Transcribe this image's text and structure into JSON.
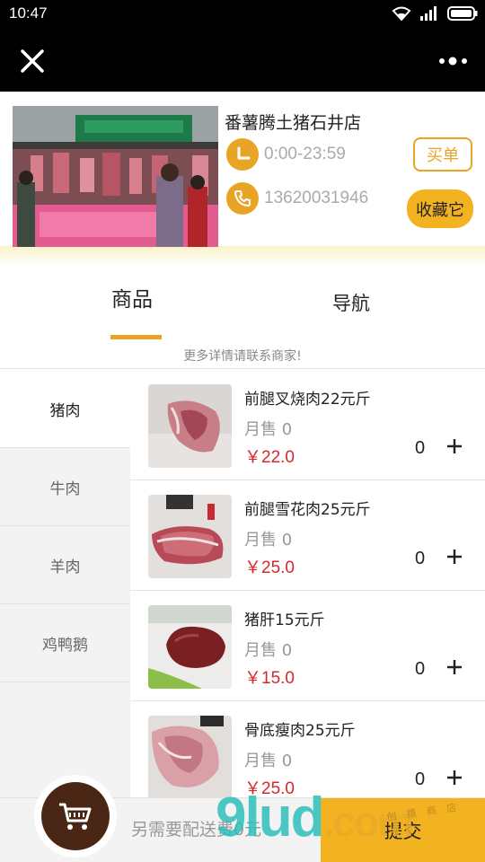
{
  "status_bar": {
    "time": "10:47",
    "icons": [
      "wifi-icon",
      "signal-icon",
      "battery-icon"
    ]
  },
  "title_bar": {
    "icons": [
      "close-icon",
      "more-icon"
    ]
  },
  "store": {
    "name": "番薯腾土猪石井店",
    "hours": "0:00-23:59",
    "phone": "13620031946",
    "buy_label": "买单",
    "favorite_label": "收藏它"
  },
  "tabs": [
    {
      "label": "商品",
      "active": true
    },
    {
      "label": "导航",
      "active": false
    }
  ],
  "hint": "更多详情请联系商家!",
  "categories": [
    {
      "label": "猪肉",
      "active": true
    },
    {
      "label": "牛肉",
      "active": false
    },
    {
      "label": "羊肉",
      "active": false
    },
    {
      "label": "鸡鸭鹅",
      "active": false
    }
  ],
  "products": [
    {
      "name": "前腿叉烧肉22元斤",
      "sold": "月售 0",
      "price": "￥22.0",
      "quantity": "0"
    },
    {
      "name": "前腿雪花肉25元斤",
      "sold": "月售 0",
      "price": "￥25.0",
      "quantity": "0"
    },
    {
      "name": "猪肝15元斤",
      "sold": "月售 0",
      "price": "￥15.0",
      "quantity": "0"
    },
    {
      "name": "骨底瘦肉25元斤",
      "sold": "月售 0",
      "price": "￥25.0",
      "quantity": "0"
    }
  ],
  "bottom_bar": {
    "delivery_text": "另需要配送费0元",
    "submit_label": "提交"
  },
  "watermark": {
    "brand": "9lud",
    "suffix": ".com",
    "small": "创 猿 商 店"
  },
  "colors": {
    "accent": "#f3b21f",
    "accent_border": "#e8a425",
    "price": "#d4282d",
    "cart": "#4a2714"
  }
}
